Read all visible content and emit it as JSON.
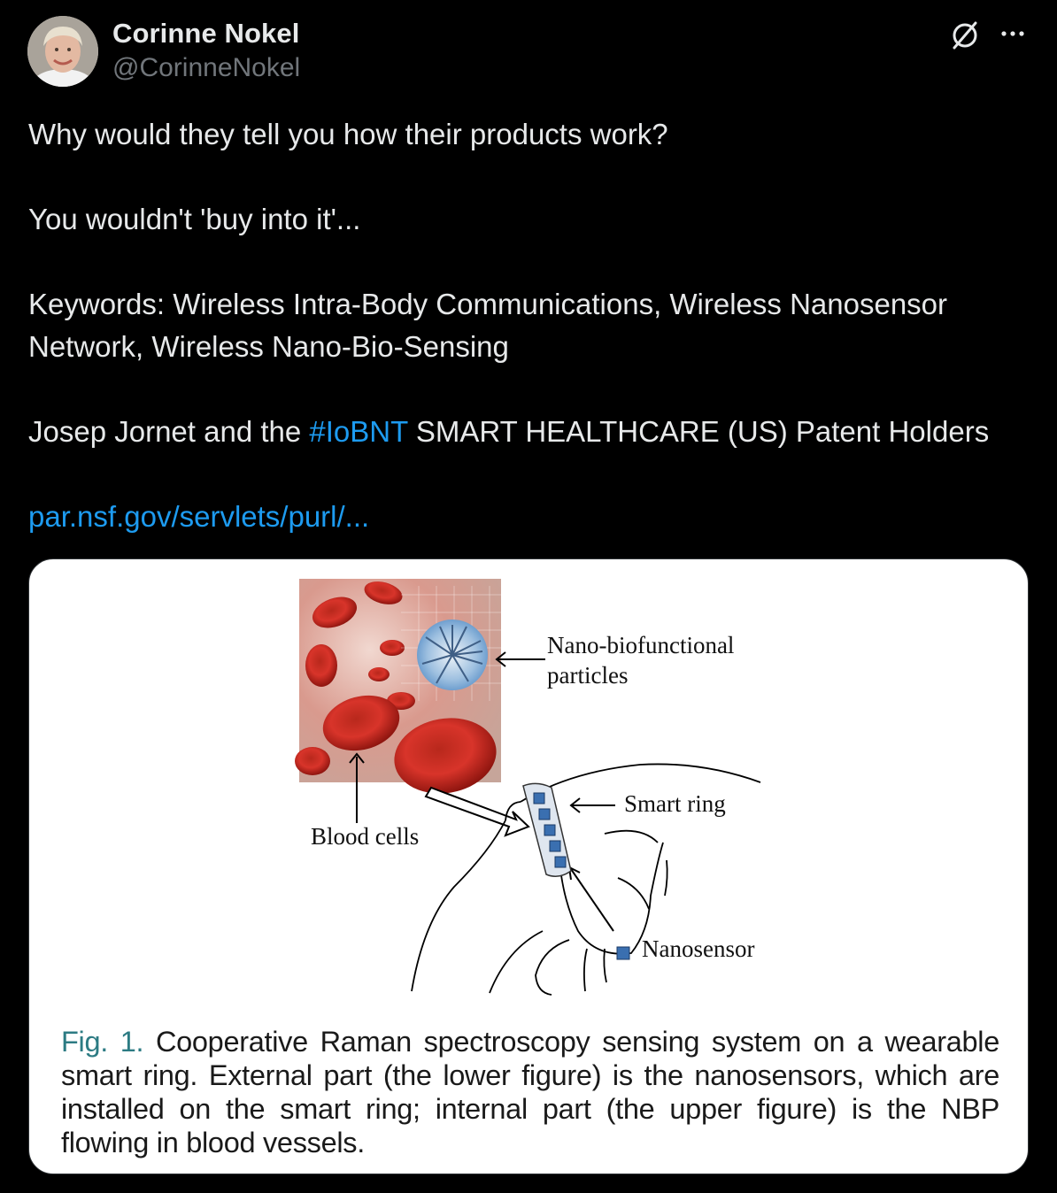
{
  "author": {
    "name": "Corinne Nokel",
    "handle": "@CorinneNokel"
  },
  "tweet": {
    "line1": "Why would they tell you how their products work?",
    "line2": "You wouldn't 'buy into it'...",
    "line3a": "Keywords: Wireless Intra-Body Communications, Wireless Nanosensor",
    "line3b": "Network, Wireless Nano-Bio-Sensing",
    "line4_prefix": "Josep Jornet and the ",
    "line4_hashtag": "#IoBNT",
    "line4_suffix": " SMART HEALTHCARE (US) Patent Holders",
    "link_text": "par.nsf.gov/servlets/purl/..."
  },
  "figure": {
    "label_nbp_line1": "Nano-biofunctional",
    "label_nbp_line2": "particles",
    "label_smart_ring": "Smart ring",
    "label_blood_cells": "Blood cells",
    "label_nanosensor": "Nanosensor",
    "caption_label": "Fig. 1.",
    "caption_text": " Cooperative Raman spectroscopy sensing system on a wearable smart ring. External part (the lower figure) is the nanosensors, which are installed on the smart ring; internal part (the upper figure) is the NBP flowing in blood vessels."
  },
  "colors": {
    "background": "#000000",
    "text": "#e7e9ea",
    "muted": "#71767b",
    "link": "#1d9bf0",
    "caption_label": "#2c7b83"
  },
  "icons": [
    "avatar",
    "grok-icon",
    "more-icon",
    "nanosensor-icon"
  ]
}
